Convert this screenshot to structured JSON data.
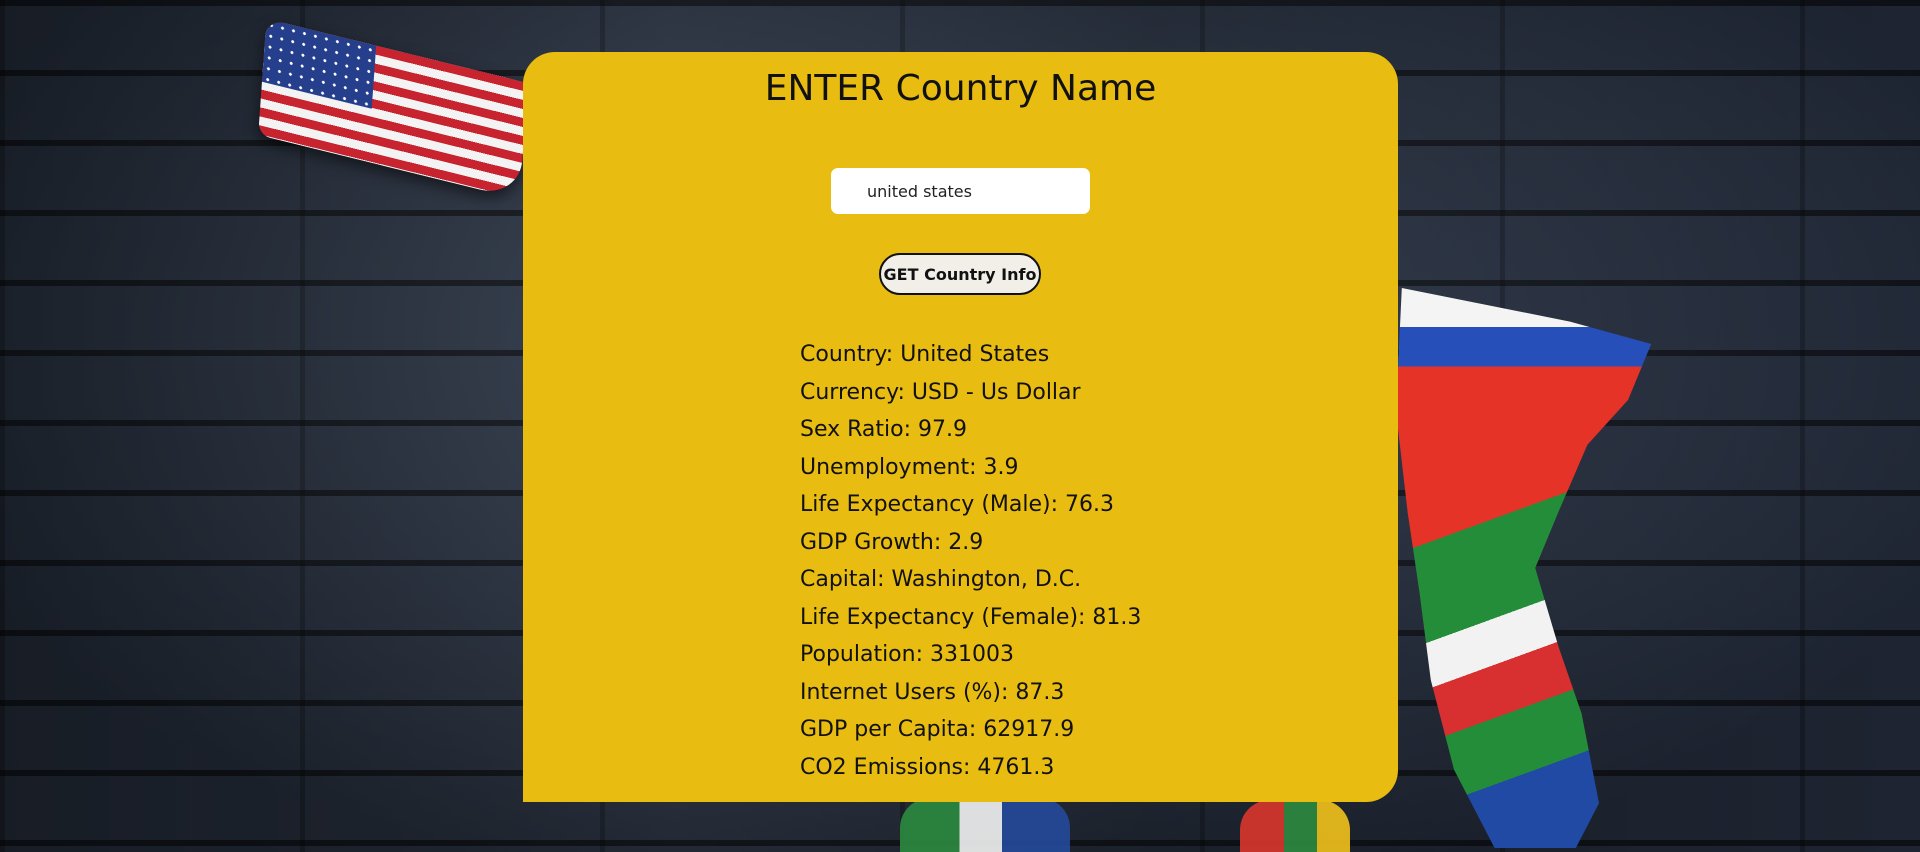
{
  "page": {
    "title": "ENTER Country Name"
  },
  "search": {
    "value": "united states"
  },
  "button": {
    "label": "GET Country Info"
  },
  "info": [
    "Country: United States",
    "Currency: USD - Us Dollar",
    "Sex Ratio: 97.9",
    "Unemployment: 3.9",
    "Life Expectancy (Male): 76.3",
    "GDP Growth: 2.9",
    "Capital: Washington, D.C.",
    "Life Expectancy (Female): 81.3",
    "Population: 331003",
    "Internet Users (%): 87.3",
    "GDP per Capita: 62917.9",
    "CO2 Emissions: 4761.3"
  ],
  "colors": {
    "card": "#e8bc10",
    "button_bg": "#f1efe8",
    "text": "#111111"
  },
  "icons": {
    "background": "brick-wall-world-flags-image"
  }
}
